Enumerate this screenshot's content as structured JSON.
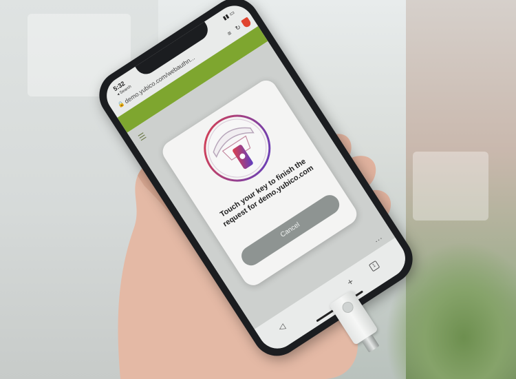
{
  "photo": {
    "subject": "",
    "colors": {
      "green_band": "#7ea62f",
      "phone": "#1b1d20",
      "dialog": "#f4f4f3",
      "cancel_button": "#8e9492",
      "shield": "#e0442f"
    }
  },
  "phone": {
    "status": {
      "time": "5:32",
      "back_label": "◂ Search"
    },
    "browser": {
      "url": "demo.yubico.com/webauthn..."
    },
    "dialog": {
      "message": "Touch your key to finish the request for demo.yubico.com",
      "cancel_label": "Cancel"
    }
  },
  "icons": [
    "lock-icon",
    "menu-icon",
    "reload-icon",
    "brave-shield-icon",
    "hamburger-icon",
    "back-icon",
    "plus-icon",
    "tabs-icon",
    "more-icon",
    "security-key-illustration"
  ]
}
